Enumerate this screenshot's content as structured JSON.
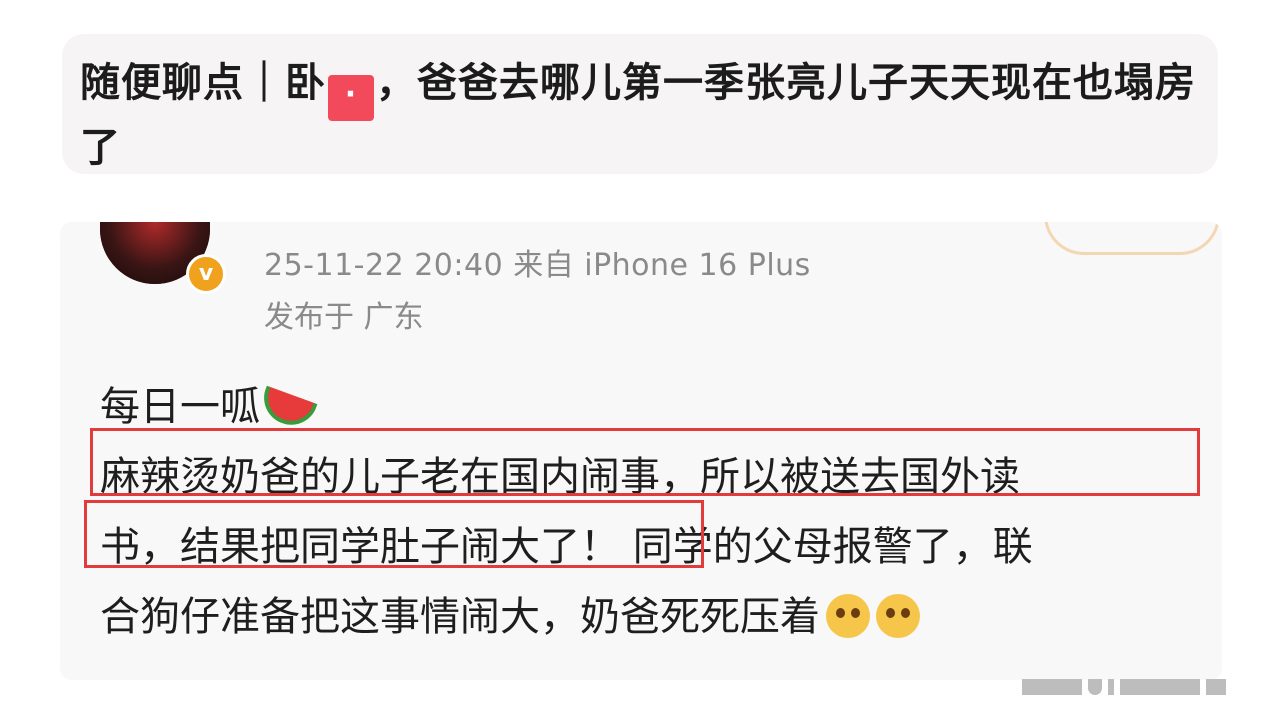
{
  "title": {
    "part1": "随便聊点｜卧",
    "redact_glyph": "·",
    "part2": "，爸爸去哪儿第一季张亮儿子天天现在也塌房了"
  },
  "post": {
    "timestamp_source": "25-11-22 20:40  来自 iPhone 16 Plus",
    "location": "发布于 广东",
    "lines": [
      "每日一呱",
      "麻辣烫奶爸的儿子老在国内闹事，所以被送去国外读",
      "书，结果把同学肚子闹大了！",
      " 同学的父母报警了，联",
      "合狗仔准备把这事情闹大，奶爸死死压着"
    ],
    "badge": "v"
  },
  "colors": {
    "highlight": "#e23b3b",
    "badge": "#f0a21f",
    "meta_text": "#8a8a8a"
  },
  "icons": [
    "watermelon-icon",
    "verified-badge-icon",
    "sad-face-icon"
  ]
}
